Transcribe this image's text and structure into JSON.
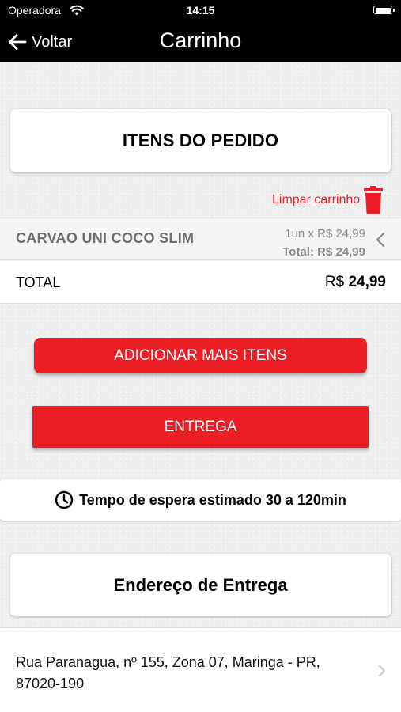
{
  "status_bar": {
    "carrier": "Operadora",
    "time": "14:15"
  },
  "nav": {
    "back_label": "Voltar",
    "title": "Carrinho"
  },
  "order_items_card": {
    "title": "ITENS DO PEDIDO"
  },
  "clear_cart": {
    "label": "Limpar carrinho"
  },
  "cart_items": [
    {
      "name": "CARVAO UNI COCO SLIM",
      "qty_price": "1un x R$ 24,99",
      "total": "Total: R$ 24,99"
    }
  ],
  "total": {
    "label": "TOTAL",
    "currency": "R$",
    "value": "24,99"
  },
  "buttons": {
    "add_more": "ADICIONAR MAIS ITENS",
    "delivery": "ENTREGA"
  },
  "wait_time": {
    "text": "Tempo de espera estimado 30 a 120min"
  },
  "delivery_address": {
    "title": "Endereço de Entrega",
    "line1": "Rua Paranagua, nº 155, Zona 07, Maringa - PR,",
    "line2": "87020-190"
  },
  "colors": {
    "accent": "#ec1d24",
    "nav_background": "#000000"
  },
  "icons": [
    "wifi-icon",
    "battery-icon",
    "back-arrow-icon",
    "trash-icon",
    "chevron-left-icon",
    "clock-icon",
    "chevron-right-icon"
  ]
}
